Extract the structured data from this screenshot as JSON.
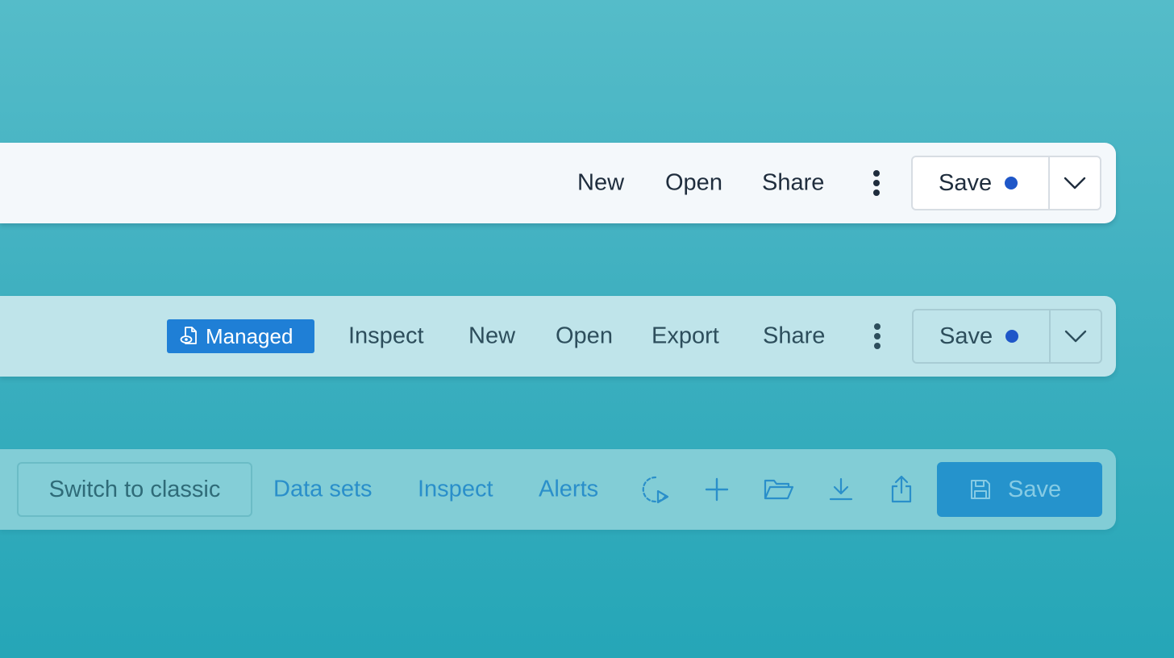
{
  "colors": {
    "unsaved_dot": "#1f57c8",
    "managed_badge_bg": "#1f7fd6",
    "primary_button_bg": "#2593cc",
    "link_blue": "#2a8fca"
  },
  "toolbar1": {
    "items": [
      {
        "label": "New"
      },
      {
        "label": "Open"
      },
      {
        "label": "Share"
      }
    ],
    "save": {
      "label": "Save",
      "unsaved_indicator": true
    }
  },
  "toolbar2": {
    "badge": {
      "label": "Managed",
      "icon": "managed-file-eye-icon"
    },
    "items": [
      {
        "label": "Inspect"
      },
      {
        "label": "New"
      },
      {
        "label": "Open"
      },
      {
        "label": "Export"
      },
      {
        "label": "Share"
      }
    ],
    "save": {
      "label": "Save",
      "unsaved_indicator": true
    }
  },
  "toolbar3": {
    "switch_label": "Switch to classic",
    "links": [
      {
        "label": "Data sets"
      },
      {
        "label": "Inspect"
      },
      {
        "label": "Alerts"
      }
    ],
    "icons": [
      "recent-play-icon",
      "plus-icon",
      "folder-open-icon",
      "download-icon",
      "share-upload-icon"
    ],
    "save": {
      "label": "Save",
      "icon": "floppy-disk-icon"
    }
  }
}
